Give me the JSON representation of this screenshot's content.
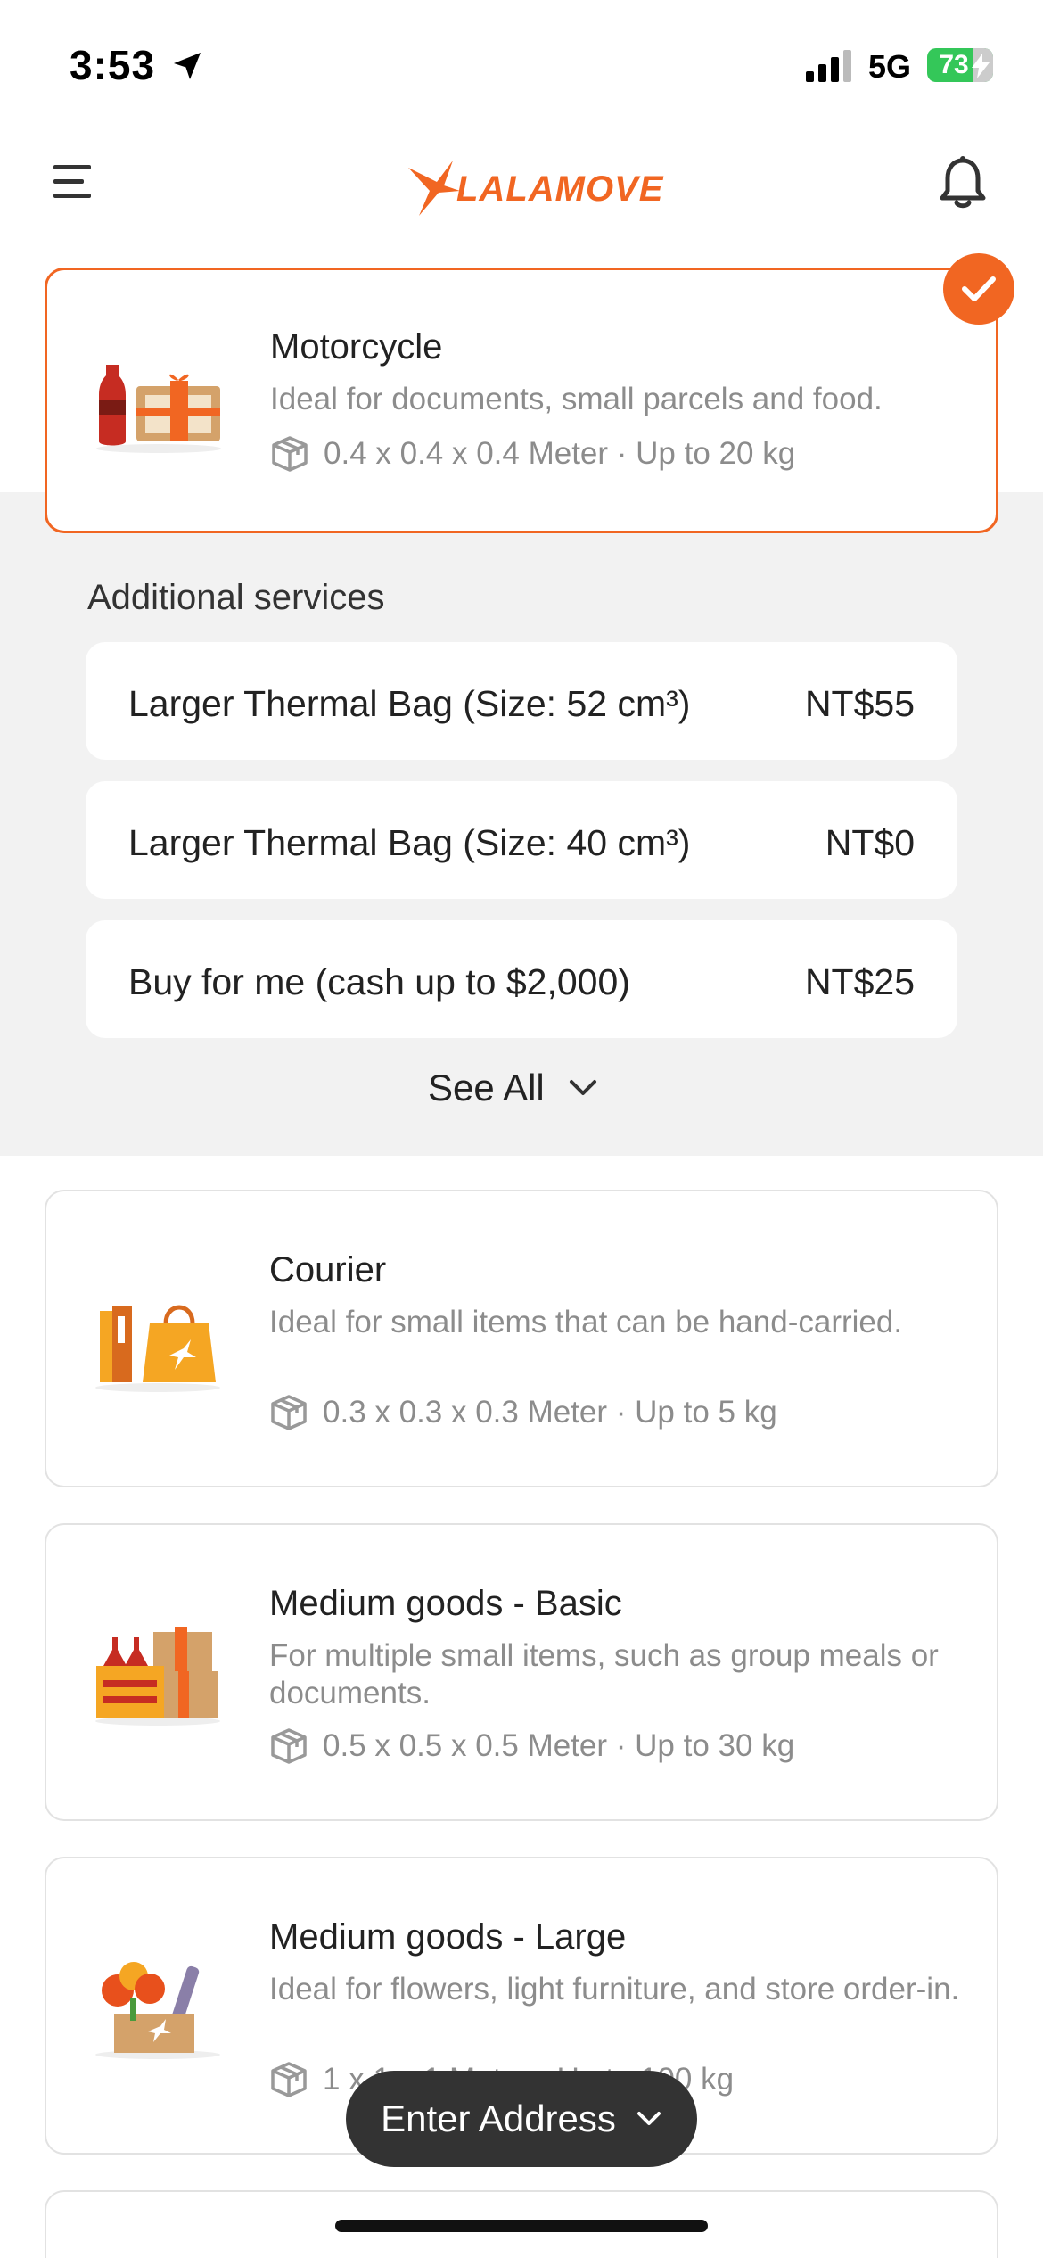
{
  "status": {
    "time": "3:53",
    "network": "5G",
    "battery": "73"
  },
  "header": {
    "logo_text": "LALAMOVE"
  },
  "selected_vehicle": {
    "title": "Motorcycle",
    "description": "Ideal for documents, small parcels and food.",
    "spec": "0.4 x 0.4 x 0.4 Meter · Up to 20 kg"
  },
  "additional_services": {
    "label": "Additional services",
    "items": [
      {
        "name": "Larger Thermal Bag (Size: 52 cm³)",
        "price": "NT$55"
      },
      {
        "name": "Larger Thermal Bag (Size: 40 cm³)",
        "price": "NT$0"
      },
      {
        "name": "Buy for me (cash up to $2,000)",
        "price": "NT$25"
      }
    ],
    "see_all": "See All"
  },
  "vehicles": [
    {
      "title": "Courier",
      "description": "Ideal for small items that can be hand-carried.",
      "spec": "0.3 x 0.3 x 0.3 Meter · Up to 5 kg"
    },
    {
      "title": "Medium goods - Basic",
      "description": "For multiple small items, such as group meals or documents.",
      "spec": "0.5 x 0.5 x 0.5 Meter · Up to 30 kg"
    },
    {
      "title": "Medium goods - Large",
      "description": "Ideal for flowers, light furniture, and store order-in.",
      "spec": "1 x 1 x 1 Meter · Up to 100 kg"
    }
  ],
  "bottom": {
    "enter_address": "Enter Address"
  },
  "colors": {
    "accent": "#f16622",
    "battery": "#34c759",
    "band": "#f2f2f2"
  }
}
